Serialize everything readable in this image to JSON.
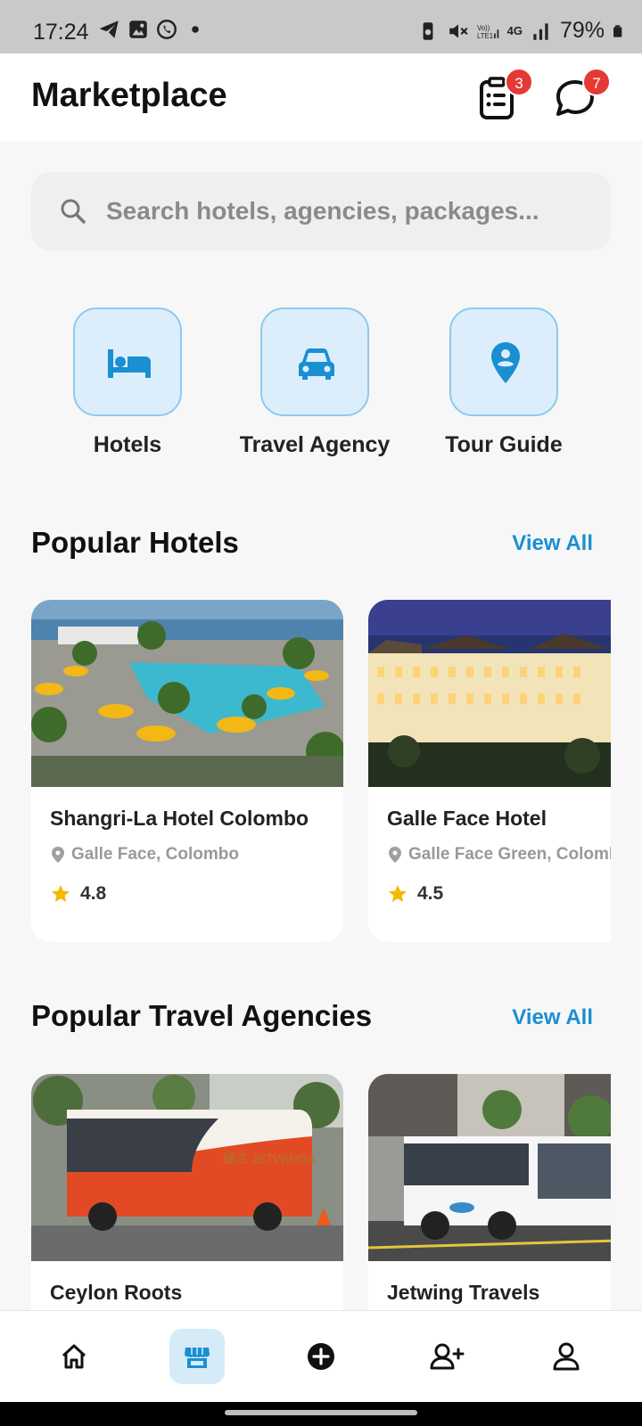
{
  "status_bar": {
    "time": "17:24",
    "battery": "79%",
    "network_label": "4G"
  },
  "header": {
    "title": "Marketplace",
    "bookings_badge": "3",
    "messages_badge": "7"
  },
  "search": {
    "placeholder": "Search hotels, agencies, packages..."
  },
  "categories": [
    {
      "label": "Hotels",
      "icon": "bed-icon"
    },
    {
      "label": "Travel Agency",
      "icon": "car-icon"
    },
    {
      "label": "Tour Guide",
      "icon": "map-pin-icon"
    }
  ],
  "popular_hotels": {
    "title": "Popular Hotels",
    "view_all": "View All",
    "items": [
      {
        "name": "Shangri-La Hotel Colombo",
        "location": "Galle Face, Colombo",
        "rating": "4.8"
      },
      {
        "name": "Galle Face Hotel",
        "location": "Galle Face Green, Colombo",
        "rating": "4.5"
      }
    ]
  },
  "popular_agencies": {
    "title": "Popular Travel Agencies",
    "view_all": "View All",
    "items": [
      {
        "name": "Ceylon Roots"
      },
      {
        "name": "Jetwing Travels"
      }
    ]
  },
  "bottom_nav": {
    "items": [
      "home-icon",
      "store-icon",
      "add-circle-icon",
      "add-friend-icon",
      "profile-icon"
    ],
    "active": "store-icon"
  },
  "colors": {
    "accent": "#1a8fd1",
    "badge": "#e53935",
    "category_bg": "#dceefb",
    "star": "#f5b800"
  }
}
